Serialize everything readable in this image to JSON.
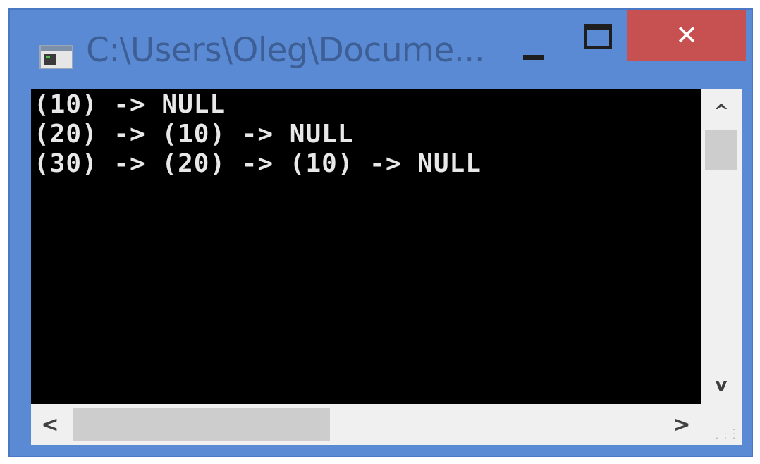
{
  "window": {
    "title": "C:\\Users\\Oleg\\Docume...",
    "icon": "console-app-icon",
    "controls": {
      "minimize_icon": "minimize-icon",
      "maximize_icon": "maximize-icon",
      "close_icon": "close-icon",
      "close_glyph": "✕"
    },
    "colors": {
      "frame": "#5b8ad4",
      "title_text": "#3d5f96",
      "close_button": "#c75050",
      "console_bg": "#000000",
      "console_text": "#e8e8e8"
    }
  },
  "console": {
    "lines": [
      "(10) -> NULL",
      "(20) -> (10) -> NULL",
      "(30) -> (20) -> (10) -> NULL"
    ]
  },
  "scrollbars": {
    "vertical": {
      "up_glyph": "^",
      "down_glyph": "v"
    },
    "horizontal": {
      "left_glyph": "<",
      "right_glyph": ">"
    }
  }
}
